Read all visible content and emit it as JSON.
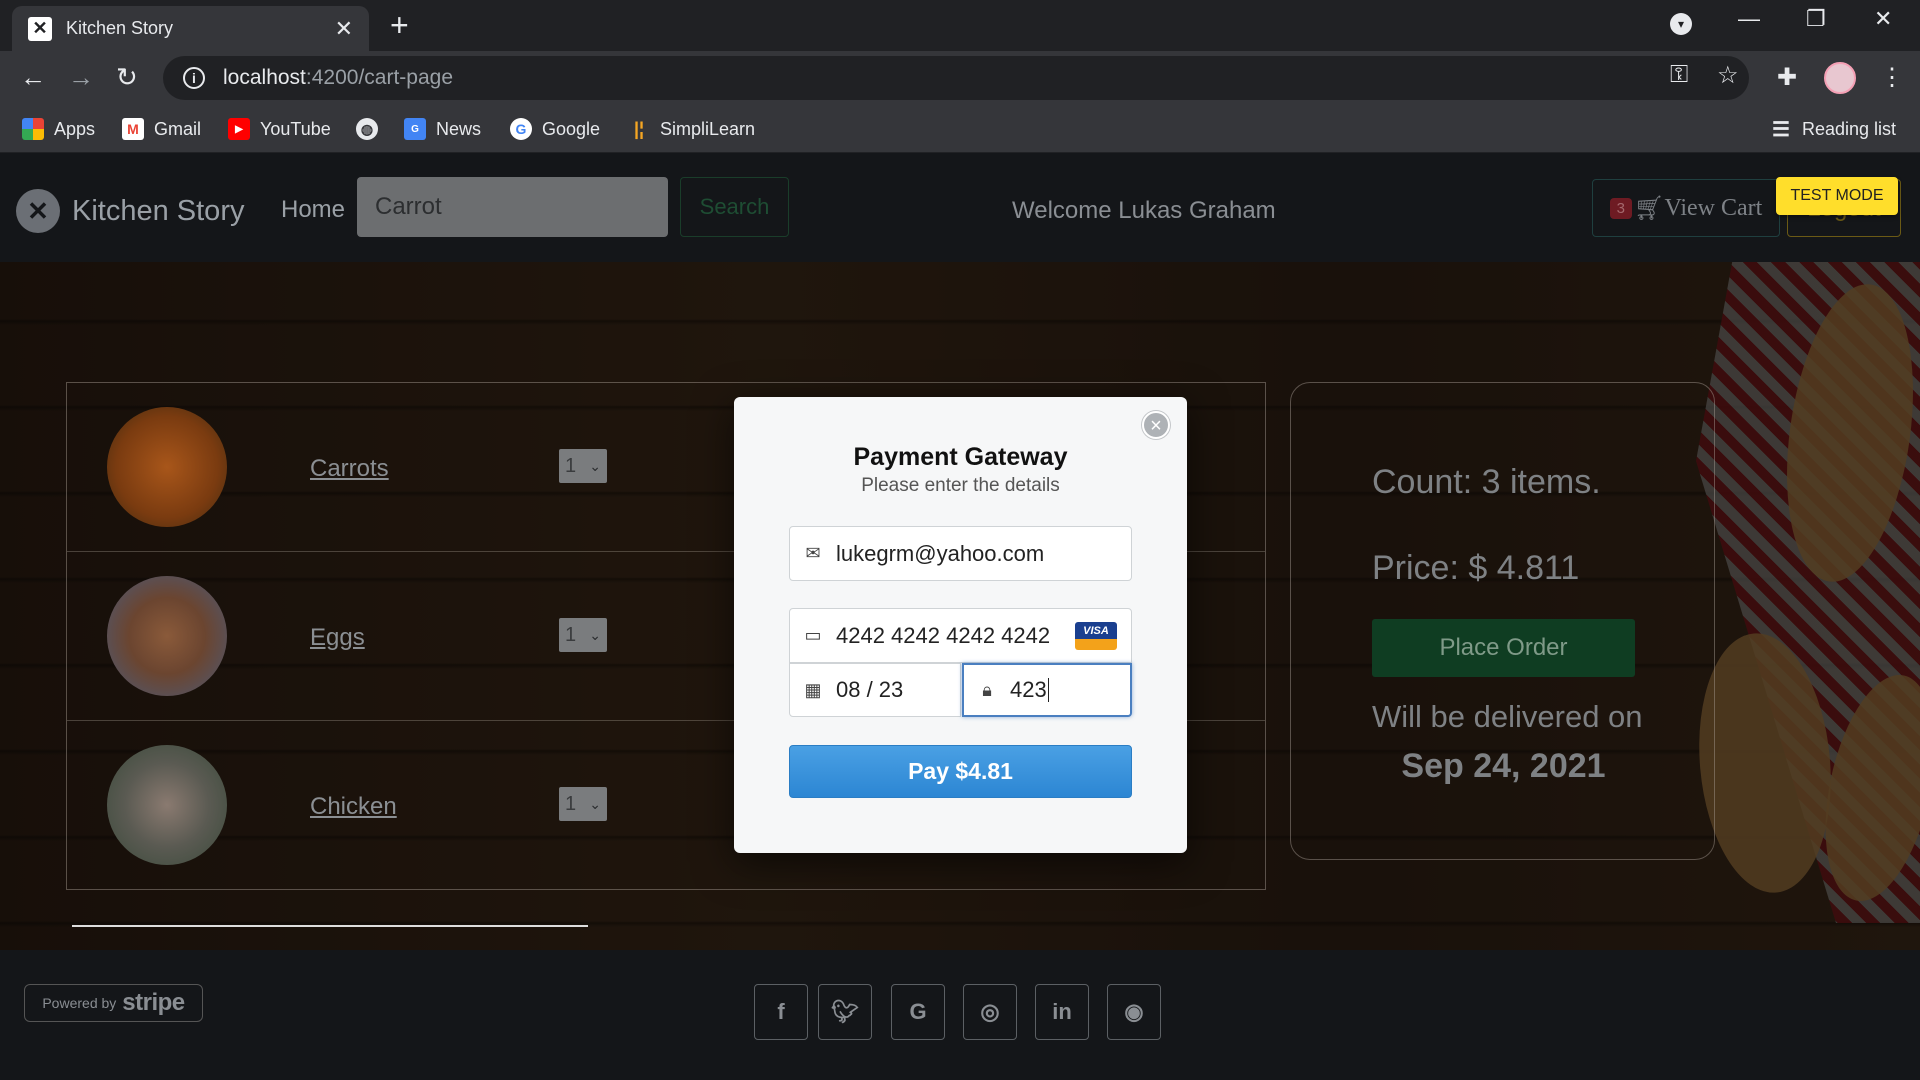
{
  "browser": {
    "tab_title": "Kitchen Story",
    "url_host": "localhost",
    "url_path": ":4200/cart-page",
    "bookmarks": [
      "Apps",
      "Gmail",
      "YouTube",
      "News",
      "Google",
      "SimpliLearn"
    ],
    "reading_list": "Reading list"
  },
  "navbar": {
    "brand": "Kitchen Story",
    "home": "Home",
    "search_value": "Carrot",
    "search_button": "Search",
    "welcome": "Welcome Lukas Graham",
    "cart_count": "3",
    "view_cart": "View Cart",
    "logout": "Logout",
    "test_mode": "TEST MODE"
  },
  "cart": {
    "items": [
      {
        "name": "Carrots",
        "qty": "1"
      },
      {
        "name": "Eggs",
        "qty": "1"
      },
      {
        "name": "Chicken",
        "qty": "1"
      }
    ]
  },
  "summary": {
    "count": "Count: 3 items.",
    "price": "Price: $ 4.811",
    "place_order": "Place Order",
    "deliver_label": "Will be delivered on",
    "deliver_date": "Sep 24, 2021"
  },
  "modal": {
    "title": "Payment Gateway",
    "subtitle": "Please enter the details",
    "email": "lukegrm@yahoo.com",
    "card_number": "4242 4242 4242 4242",
    "card_brand": "VISA",
    "expiry": "08 / 23",
    "cvc": "423",
    "pay_button": "Pay $4.81"
  },
  "footer": {
    "powered_by": "Powered by",
    "stripe": "stripe"
  },
  "colors": {
    "pay_button": "#2c86d3",
    "test_mode": "#ffde2b",
    "place_order": "#0f3d22"
  }
}
